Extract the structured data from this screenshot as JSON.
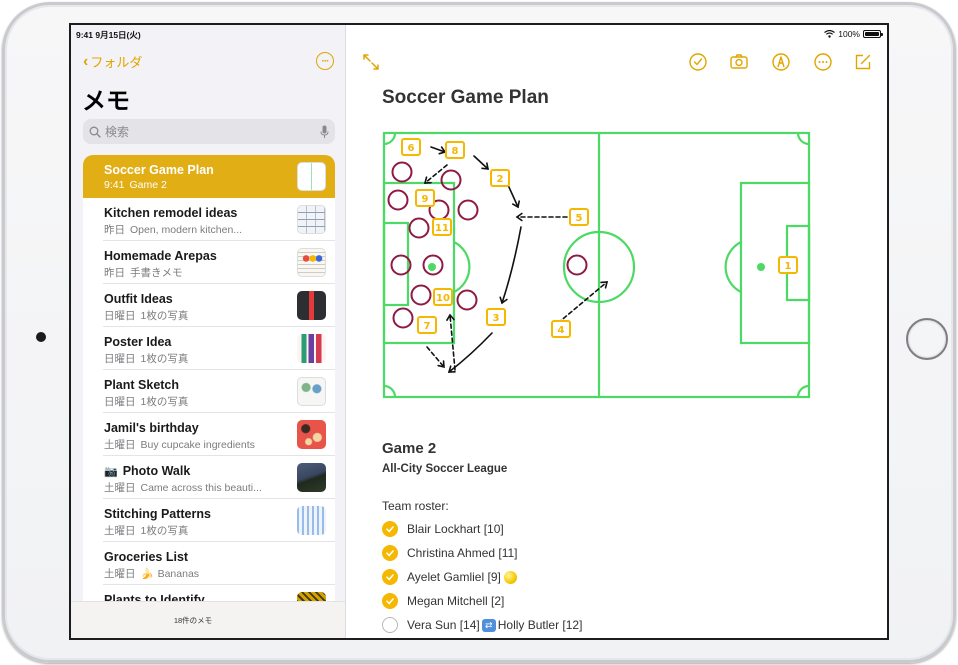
{
  "status_bar": {
    "time_date": "9:41  9月15日(火)",
    "battery_percent": "100%",
    "battery_level": 1.0
  },
  "sidebar": {
    "back_label": "フォルダ",
    "title": "メモ",
    "search_placeholder": "検索",
    "footer_count": "18件のメモ",
    "notes": [
      {
        "title": "Soccer Game Plan",
        "date": "9:41",
        "preview": "Game 2",
        "selected": true,
        "thumb": "soccer-field"
      },
      {
        "title": "Kitchen remodel ideas",
        "date": "昨日",
        "preview": "Open, modern kitchen...",
        "thumb": "floorplan"
      },
      {
        "title": "Homemade Arepas",
        "date": "昨日",
        "preview": "手書きメモ",
        "thumb": "recipe"
      },
      {
        "title": "Outfit Ideas",
        "date": "日曜日",
        "preview": "1枚の写真",
        "thumb": "photo-outfit"
      },
      {
        "title": "Poster Idea",
        "date": "日曜日",
        "preview": "1枚の写真",
        "thumb": "illustration-people"
      },
      {
        "title": "Plant Sketch",
        "date": "日曜日",
        "preview": "1枚の写真",
        "thumb": "plant-sketch"
      },
      {
        "title": "Jamil's birthday",
        "date": "土曜日",
        "preview": "Buy cupcake ingredients",
        "thumb": "cupcakes"
      },
      {
        "title": "Photo Walk",
        "date": "土曜日",
        "preview": "Came across this beauti...",
        "thumb": "photo-building",
        "title_icon": "camera-emoji"
      },
      {
        "title": "Stitching Patterns",
        "date": "土曜日",
        "preview": "1枚の写真",
        "thumb": "patterns"
      },
      {
        "title": "Groceries List",
        "date": "土曜日",
        "preview": "Bananas",
        "preview_icon": "banana-emoji"
      },
      {
        "title": "Plants to Identify",
        "date": "",
        "preview": "",
        "thumb": "leaf"
      }
    ]
  },
  "toolbar": {
    "icons": [
      "expand-icon",
      "checklist-icon",
      "camera-icon",
      "markup-icon",
      "more-icon",
      "compose-icon"
    ]
  },
  "note": {
    "title": "Soccer Game Plan",
    "game_title": "Game 2",
    "league": "All-City Soccer League",
    "roster_label": "Team roster:",
    "roster": [
      {
        "name": "Blair Lockhart [10]",
        "checked": true
      },
      {
        "name": "Christina Ahmed [11]",
        "checked": true
      },
      {
        "name": "Ayelet Gamliel [9]",
        "checked": true,
        "suffix_icon": "yellow-circle-emoji"
      },
      {
        "name": "Megan Mitchell [2]",
        "checked": true
      },
      {
        "name": "Vera Sun [14]",
        "checked": false,
        "swap_icon": "repeat-emoji",
        "swap_with": "Holly Butler [12]"
      }
    ],
    "field_drawing": {
      "player_labels": [
        "6",
        "8",
        "2",
        "9",
        "11",
        "5",
        "10",
        "3",
        "7",
        "4",
        "1"
      ],
      "colors": {
        "field_lines": "#4cd964",
        "player_boxes": "#f5b700",
        "opponents": "#8e1a45",
        "arrows": "#111111"
      }
    }
  },
  "colors": {
    "accent": "#e1a500",
    "selected_row": "#e1ae15",
    "check_fill": "#f5b700"
  }
}
